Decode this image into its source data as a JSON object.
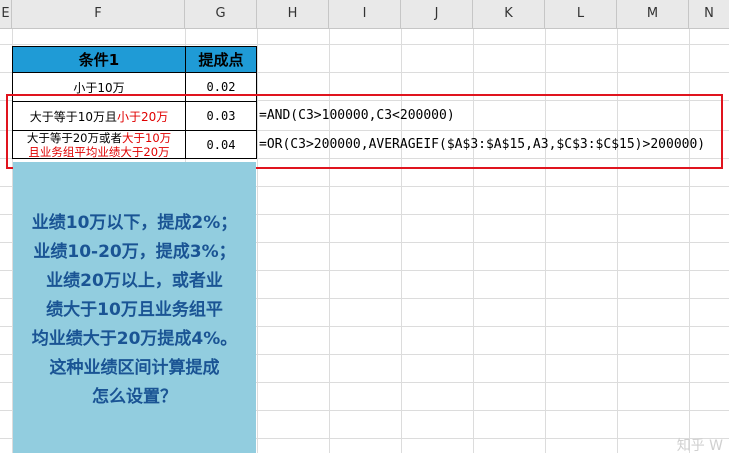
{
  "column_headers": [
    "E",
    "F",
    "G",
    "H",
    "I",
    "J",
    "K",
    "L",
    "M",
    "N"
  ],
  "table": {
    "header": {
      "condition": "条件1",
      "rate": "提成点"
    },
    "rows": [
      {
        "condition": "小于10万",
        "rate": "0.02"
      },
      {
        "condition_black": "大于等于10万且",
        "condition_red": "小于20万",
        "rate": "0.03"
      },
      {
        "line1_black": "大于等于20万或者",
        "line1_red": "大于10万",
        "line2_red": "且业务组平均业绩大于20万",
        "rate": "0.04"
      }
    ]
  },
  "formulas": [
    "=AND(C3>100000,C3<200000)",
    "=OR(C3>200000,AVERAGEIF($A$3:$A$15,A3,$C$3:$C$15)>200000)"
  ],
  "note_lines": [
    "业绩10万以下，提成2%；",
    "业绩10-20万，提成3%；",
    "业绩20万以上，或者业",
    "绩大于10万且业务组平",
    "均业绩大于20万提成4%。",
    "这种业绩区间计算提成",
    "怎么设置？"
  ],
  "watermark": "知乎 W"
}
